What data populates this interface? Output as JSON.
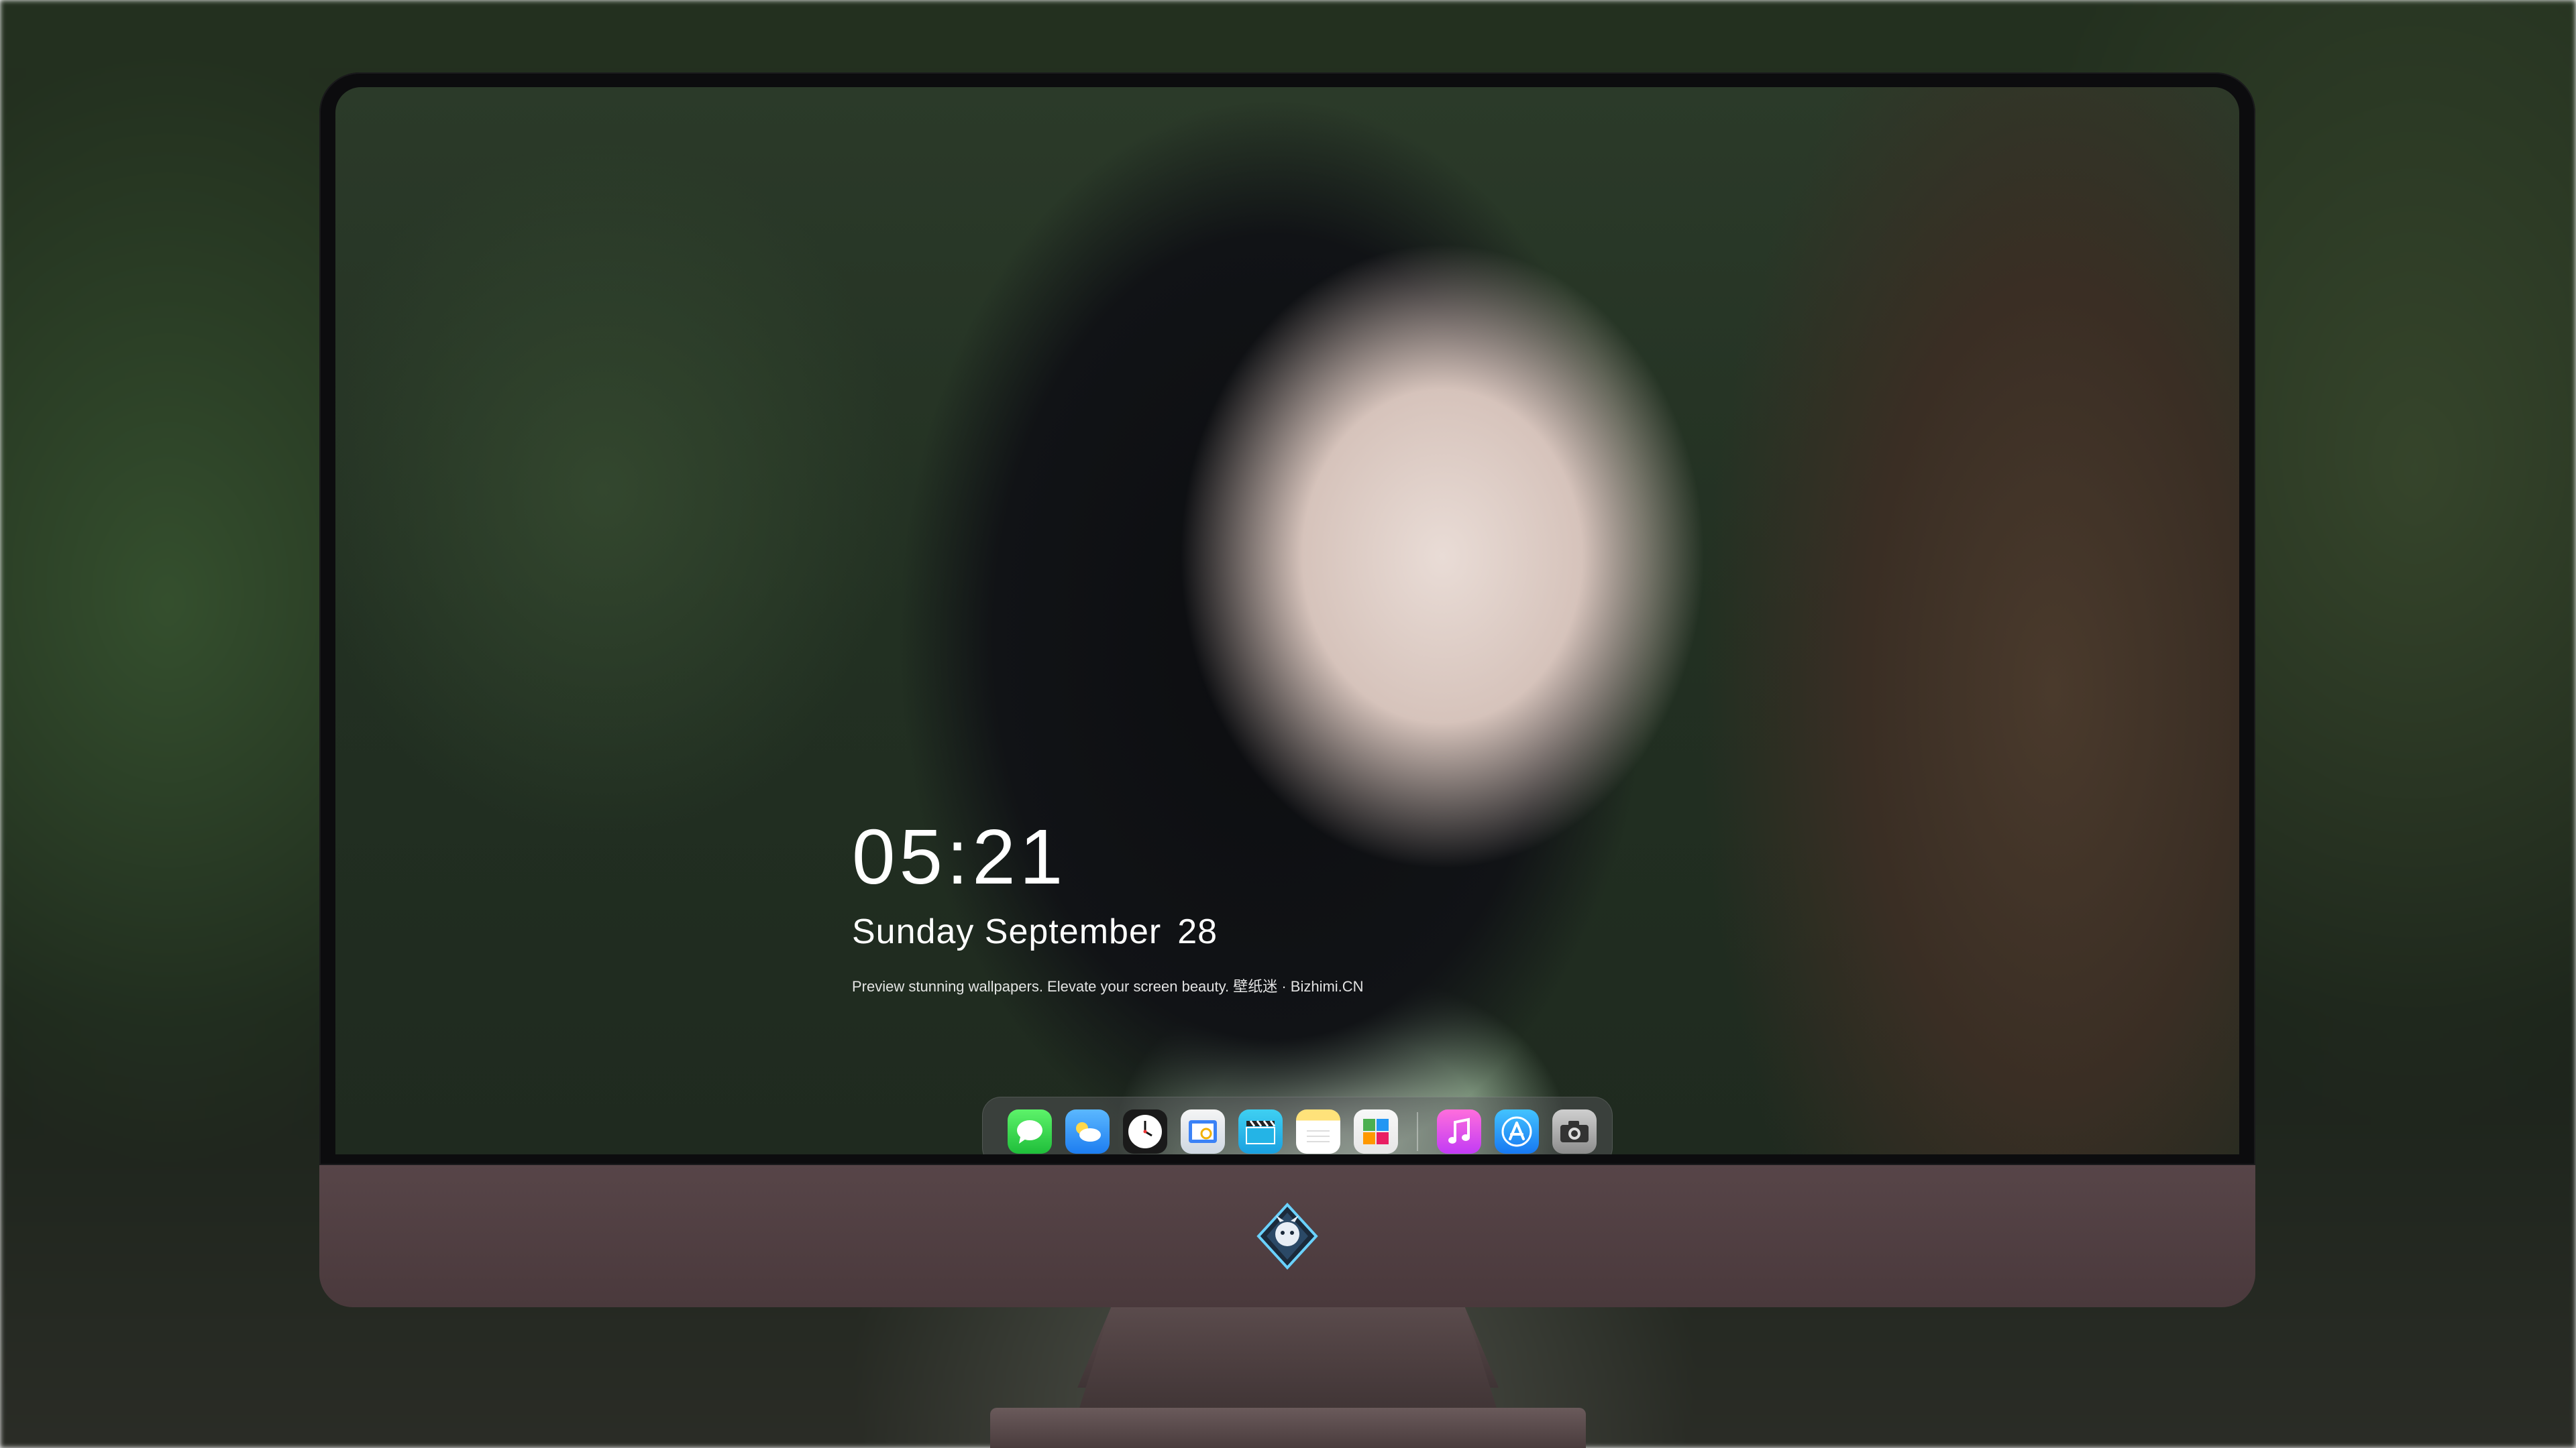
{
  "lock_screen": {
    "time": "05:21",
    "date_weekday_month": "Sunday September",
    "date_day": "28",
    "caption": "Preview stunning wallpapers. Elevate your screen beauty. 壁纸迷 · Bizhimi.CN"
  },
  "dock": {
    "apps": [
      {
        "name": "Messages",
        "icon": "messages-icon",
        "glyph": "💬"
      },
      {
        "name": "Weather",
        "icon": "weather-icon",
        "glyph": "☁"
      },
      {
        "name": "Clock",
        "icon": "clock-icon",
        "glyph": "🕐"
      },
      {
        "name": "Preview",
        "icon": "preview-icon",
        "glyph": "🖼"
      },
      {
        "name": "Videos",
        "icon": "clapperboard-icon",
        "glyph": "🎬"
      },
      {
        "name": "Notes",
        "icon": "notes-icon",
        "glyph": ""
      },
      {
        "name": "Photos",
        "icon": "photos-icon",
        "glyph": "▦"
      },
      {
        "name": "Music",
        "icon": "music-icon",
        "glyph": "♫"
      },
      {
        "name": "App Store",
        "icon": "app-store-icon",
        "glyph": "A"
      },
      {
        "name": "Camera",
        "icon": "camera-icon",
        "glyph": "📷"
      }
    ]
  },
  "colors": {
    "monitor_chin": "#574548",
    "bezel": "#0c0c0e",
    "clock_text": "#ffffff"
  }
}
